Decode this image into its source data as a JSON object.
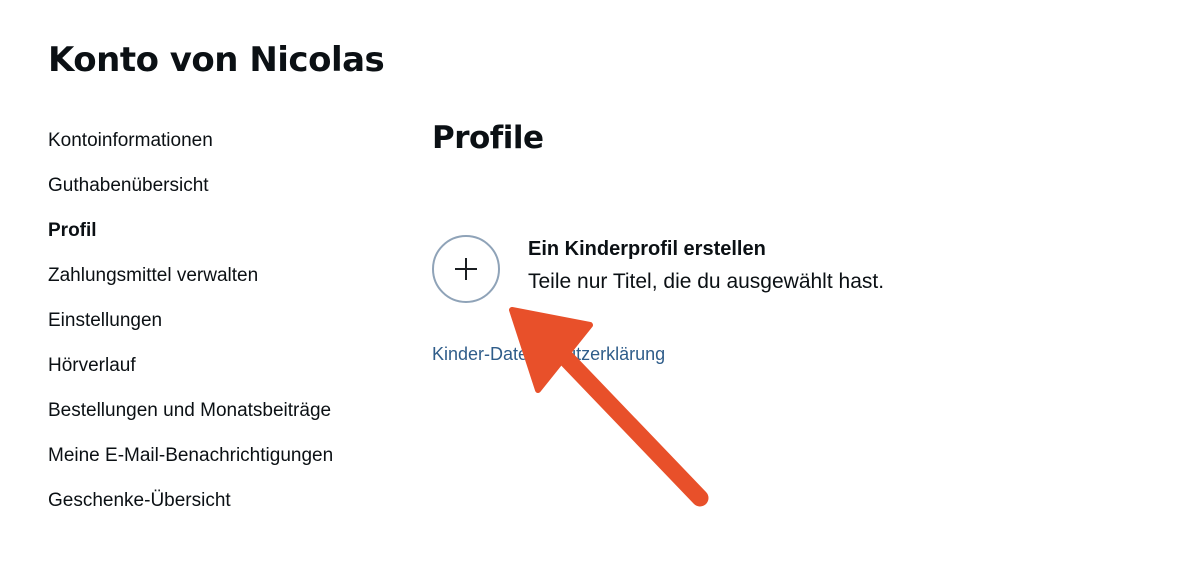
{
  "account": {
    "title": "Konto von Nicolas"
  },
  "sidebar": {
    "items": [
      {
        "label": "Kontoinformationen",
        "active": false
      },
      {
        "label": "Guthabenübersicht",
        "active": false
      },
      {
        "label": "Profil",
        "active": true
      },
      {
        "label": "Zahlungsmittel verwalten",
        "active": false
      },
      {
        "label": "Einstellungen",
        "active": false
      },
      {
        "label": "Hörverlauf",
        "active": false
      },
      {
        "label": "Bestellungen und Monatsbeiträge",
        "active": false
      },
      {
        "label": "Meine E-Mail-Benachrichtigungen",
        "active": false
      },
      {
        "label": "Geschenke-Übersicht",
        "active": false
      }
    ]
  },
  "main": {
    "title": "Profile",
    "create_profile": {
      "icon": "plus-icon",
      "title": "Ein Kinderprofil erstellen",
      "subtitle": "Teile nur Titel, die du ausgewählt hast."
    },
    "privacy_link": "Kinder-Datenschutzerklärung"
  },
  "annotation": {
    "type": "arrow",
    "color": "#e8502a"
  },
  "colors": {
    "text": "#0b1014",
    "link": "#2f5d8a",
    "circle_border": "#8fa3b8",
    "background": "#ffffff"
  }
}
